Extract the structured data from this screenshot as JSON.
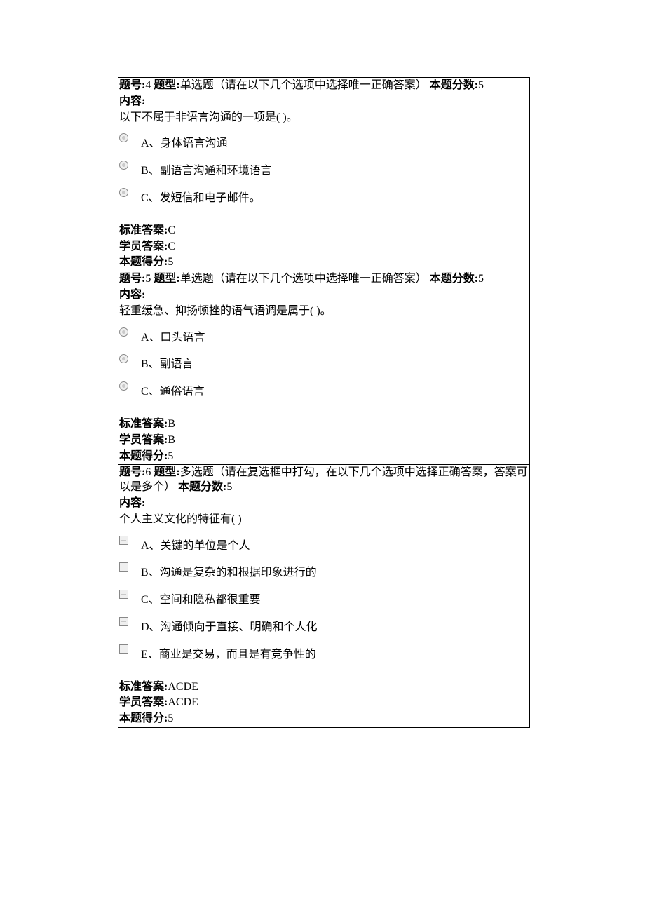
{
  "labels": {
    "qnum_prefix": "题号:",
    "qtype_prefix": " 题型:",
    "qscore_prefix": "  本题分数:",
    "content_label": "内容:",
    "std_answer_label": "标准答案:",
    "stu_answer_label": "学员答案:",
    "got_score_label": "本题得分:"
  },
  "qtypes": {
    "single": "单选题（请在以下几个选项中选择唯一正确答案）",
    "multi": "多选题（请在复选框中打勾，在以下几个选项中选择正确答案，答案可以是多个）"
  },
  "questions": [
    {
      "number": "4",
      "typeKey": "single",
      "score": "5",
      "prompt": "以下不属于非语言沟通的一项是( )。",
      "options": [
        "A、身体语言沟通",
        "B、副语言沟通和环境语言",
        "C、发短信和电子邮件。"
      ],
      "std_answer": "C",
      "stu_answer": "C",
      "got_score": "5",
      "control": "radio"
    },
    {
      "number": "5",
      "typeKey": "single",
      "score": "5",
      "prompt": "轻重缓急、抑扬顿挫的语气语调是属于( )。",
      "options": [
        "A、口头语言",
        "B、副语言",
        "C、通俗语言"
      ],
      "std_answer": "B",
      "stu_answer": "B",
      "got_score": "5",
      "control": "radio"
    },
    {
      "number": "6",
      "typeKey": "multi",
      "score": "5",
      "prompt": "个人主义文化的特征有( )",
      "options": [
        "A、关键的单位是个人",
        "B、沟通是复杂的和根据印象进行的",
        "C、空间和隐私都很重要",
        "D、沟通倾向于直接、明确和个人化",
        "E、商业是交易，而且是有竞争性的"
      ],
      "std_answer": "ACDE",
      "stu_answer": "ACDE",
      "got_score": "5",
      "control": "checkbox"
    }
  ]
}
